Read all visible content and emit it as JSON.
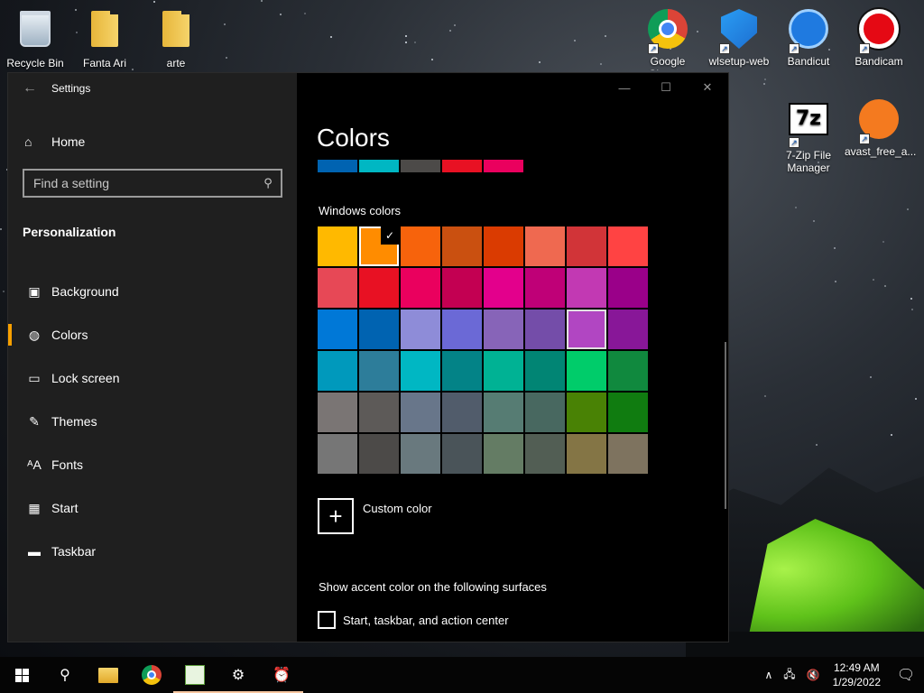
{
  "desktop": {
    "icons": [
      {
        "label": "Recycle Bin",
        "type": "bin"
      },
      {
        "label": "Fanta Ari",
        "type": "folder"
      },
      {
        "label": "arte",
        "type": "folder"
      },
      {
        "label": "Google Chrome",
        "type": "chrome"
      },
      {
        "label": "wlsetup-web",
        "type": "wls"
      },
      {
        "label": "Bandicut",
        "type": "bandicut"
      },
      {
        "label": "Bandicam",
        "type": "bandicam"
      },
      {
        "label": "7-Zip File Manager",
        "type": "zip"
      },
      {
        "label": "avast_free_a...",
        "type": "avast"
      }
    ],
    "zip_glyph": "7z"
  },
  "window": {
    "title": "Settings",
    "back_icon": "←",
    "minimize_icon": "—",
    "maximize_icon": "☐",
    "close_icon": "✕"
  },
  "nav": {
    "home_label": "Home",
    "home_icon": "⌂",
    "search_placeholder": "Find a setting",
    "search_icon": "⚲",
    "section_title": "Personalization",
    "items": [
      {
        "label": "Background",
        "icon": "▣"
      },
      {
        "label": "Colors",
        "icon": "◍",
        "active": true
      },
      {
        "label": "Lock screen",
        "icon": "▭"
      },
      {
        "label": "Themes",
        "icon": "✎"
      },
      {
        "label": "Fonts",
        "icon": "ᴬA"
      },
      {
        "label": "Start",
        "icon": "▦"
      },
      {
        "label": "Taskbar",
        "icon": "▬"
      }
    ]
  },
  "content": {
    "title": "Colors",
    "recent_colors": [
      "#0063b1",
      "#00b7c3",
      "#4c4a48",
      "#e81123",
      "#ea005e"
    ],
    "windows_colors_label": "Windows colors",
    "swatches": [
      "#ffb900",
      "#ff8c00",
      "#f7630c",
      "#ca5010",
      "#da3b01",
      "#ef6950",
      "#d13438",
      "#ff4343",
      "#e74856",
      "#e81123",
      "#ea005e",
      "#c30052",
      "#e3008c",
      "#bf0077",
      "#c239b3",
      "#9a0089",
      "#0078d7",
      "#0063b1",
      "#8e8cd8",
      "#6b69d6",
      "#8764b8",
      "#744da9",
      "#b146c2",
      "#881798",
      "#0099bc",
      "#2d7d9a",
      "#00b7c3",
      "#038387",
      "#00b294",
      "#018574",
      "#00cc6a",
      "#10893e",
      "#7a7574",
      "#5d5a58",
      "#68768a",
      "#515c6b",
      "#567c73",
      "#486860",
      "#498205",
      "#107c10",
      "#767676",
      "#4c4a48",
      "#69797e",
      "#4a5459",
      "#647c64",
      "#525e54",
      "#847545",
      "#7e735f"
    ],
    "selected_index": 1,
    "highlight_index": 22,
    "check_glyph": "✓",
    "custom_color_label": "Custom color",
    "plus_glyph": "+",
    "surfaces_label": "Show accent color on the following surfaces",
    "checkbox_label": "Start, taskbar, and action center"
  },
  "taskbar": {
    "search_icon": "⚲",
    "settings_icon": "⚙",
    "alarm_icon": "⏰",
    "tray_chevron": "∧",
    "network_icon": "🖧",
    "volume_icon": "🔇",
    "time": "12:49 AM",
    "date": "1/29/2022",
    "notification_icon": "🗨"
  }
}
